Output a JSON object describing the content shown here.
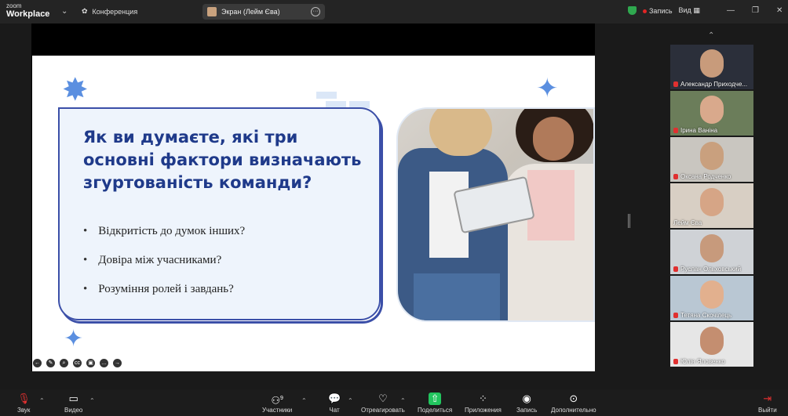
{
  "app": {
    "logo_line1": "zoom",
    "logo_line2": "Workplace"
  },
  "topbar": {
    "conference_label": "Конференция",
    "screen_share_label": "Экран (Лейм Єва)",
    "record_label": "Запись",
    "view_label": "Вид"
  },
  "slide": {
    "title": "Як ви думаєте, які три основні фактори визначають згуртованість команди?",
    "bullets": [
      "Відкритість до думок інших?",
      "Довіра між учасниками?",
      "Розуміння ролей і завдань?"
    ]
  },
  "participants": [
    {
      "name": "Александр Приходче...",
      "bg": "#2b2f3a",
      "face": "#c89b7b",
      "active": false
    },
    {
      "name": "Ірина Ваніна",
      "bg": "#6b7d5a",
      "face": "#d9a98c",
      "active": false
    },
    {
      "name": "Оксана Родченко",
      "bg": "#c9c6c0",
      "face": "#c9a07e",
      "active": false
    },
    {
      "name": "Лейм Єва",
      "bg": "#d8cfc4",
      "face": "#d6a586",
      "active": true
    },
    {
      "name": "Руслан Ольховський",
      "bg": "#cfd2d6",
      "face": "#c79a7c",
      "active": false
    },
    {
      "name": "Тетяна Скочілець",
      "bg": "#b9c7d3",
      "face": "#e2b08e",
      "active": false
    },
    {
      "name": "Юлія Яловенко",
      "bg": "#e6e6e6",
      "face": "#c48e70",
      "active": false
    }
  ],
  "toolbar": {
    "audio": "Звук",
    "video": "Видео",
    "participants": "Участники",
    "participants_count": "9",
    "chat": "Чат",
    "react": "Отреагировать",
    "share": "Поделиться",
    "apps": "Приложения",
    "record": "Запись",
    "more": "Дополнительно",
    "leave": "Выйти"
  }
}
